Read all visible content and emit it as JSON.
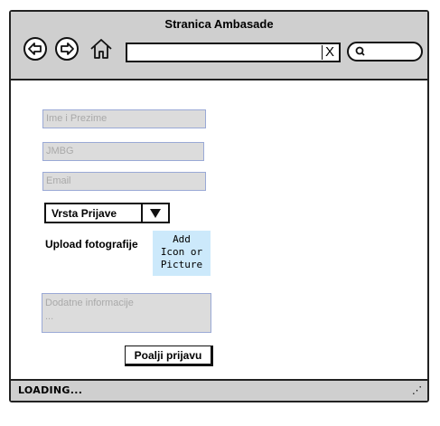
{
  "window": {
    "title": "Stranica Ambasade"
  },
  "toolbar": {
    "url_value": "",
    "url_clear": "X",
    "search_value": ""
  },
  "form": {
    "name_placeholder": "Ime i Prezime",
    "jmbg_placeholder": "JMBG",
    "email_placeholder": "Email",
    "type_select": "Vrsta Prijave",
    "upload_label": "Upload fotografije",
    "picture_line1": "Add",
    "picture_line2": "Icon or",
    "picture_line3": "Picture",
    "info_placeholder": "Dodatne informacije",
    "info_placeholder2": "...",
    "submit_label": "Poalji prijavu"
  },
  "status": {
    "text": "LOADING...",
    "grip": "⋰"
  }
}
